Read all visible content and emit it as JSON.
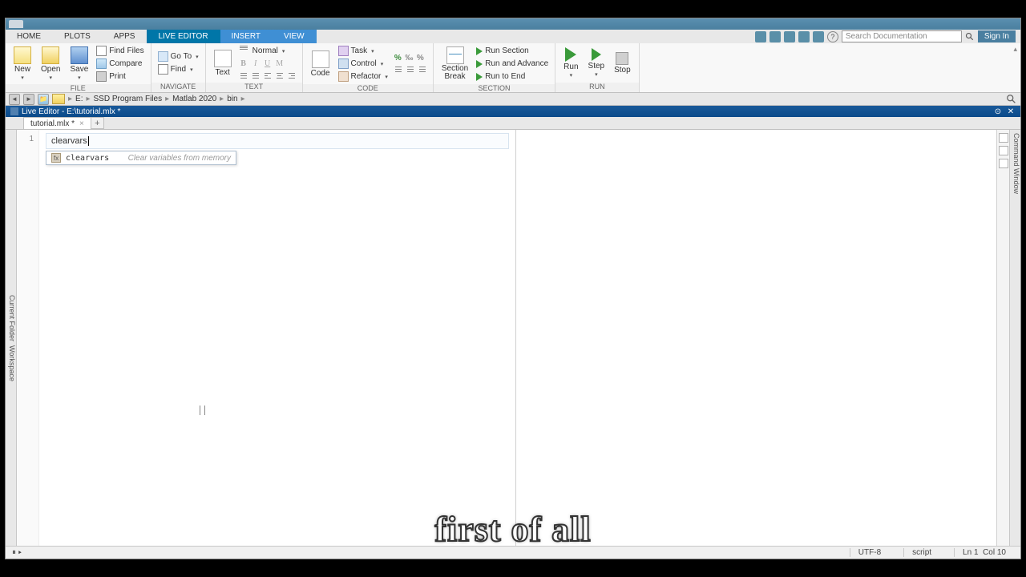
{
  "ribbonTabs": {
    "home": "HOME",
    "plots": "PLOTS",
    "apps": "APPS",
    "liveEditor": "LIVE EDITOR",
    "insert": "INSERT",
    "view": "VIEW"
  },
  "signIn": "Sign In",
  "searchPlaceholder": "Search Documentation",
  "ribbon": {
    "file": {
      "new": "New",
      "open": "Open",
      "save": "Save",
      "findFiles": "Find Files",
      "compare": "Compare",
      "print": "Print",
      "label": "FILE"
    },
    "navigate": {
      "goto": "Go To",
      "find": "Find",
      "label": "NAVIGATE"
    },
    "text": {
      "text": "Text",
      "normal": "Normal",
      "b": "B",
      "i": "I",
      "u": "U",
      "m": "M",
      "label": "TEXT"
    },
    "code": {
      "code": "Code",
      "task": "Task",
      "control": "Control",
      "refactor": "Refactor",
      "label": "CODE"
    },
    "section": {
      "break": "Section\nBreak",
      "runSection": "Run Section",
      "runAdvance": "Run and Advance",
      "runToEnd": "Run to End",
      "label": "SECTION"
    },
    "run": {
      "run": "Run",
      "step": "Step",
      "stop": "Stop",
      "label": "RUN"
    }
  },
  "breadcrumb": {
    "drive": "E:",
    "p1": "SSD Program Files",
    "p2": "Matlab 2020",
    "p3": "bin"
  },
  "titlebar": "Live Editor - E:\\tutorial.mlx *",
  "fileTab": "tutorial.mlx *",
  "lineNumber": "1",
  "codeText": "clearvars",
  "suggestion": {
    "name": "clearvars",
    "desc": "Clear variables from memory"
  },
  "sidebarLeft": "Current Folder",
  "sidebarLeft2": "Workspace",
  "sidebarFar": "Command Window",
  "status": {
    "encoding": "UTF-8",
    "type": "script",
    "ln": "Ln",
    "lnv": "1",
    "col": "Col",
    "colv": "10"
  },
  "subtitle": "first of all"
}
